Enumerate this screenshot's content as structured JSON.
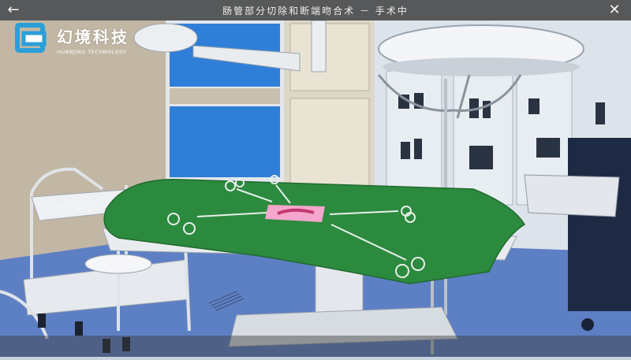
{
  "header": {
    "title": "肠管部分切除和断端吻合术 － 手术中",
    "back_icon": "←",
    "close_icon": "✕"
  },
  "logo": {
    "cn": "幻境科技",
    "en": "HUANJING TECHNOLOGY"
  },
  "colors": {
    "drape": "#2c8a3e",
    "wall_blue": "#2f7fd8",
    "floor": "#5d7fc4",
    "header_bg": "#464646"
  }
}
